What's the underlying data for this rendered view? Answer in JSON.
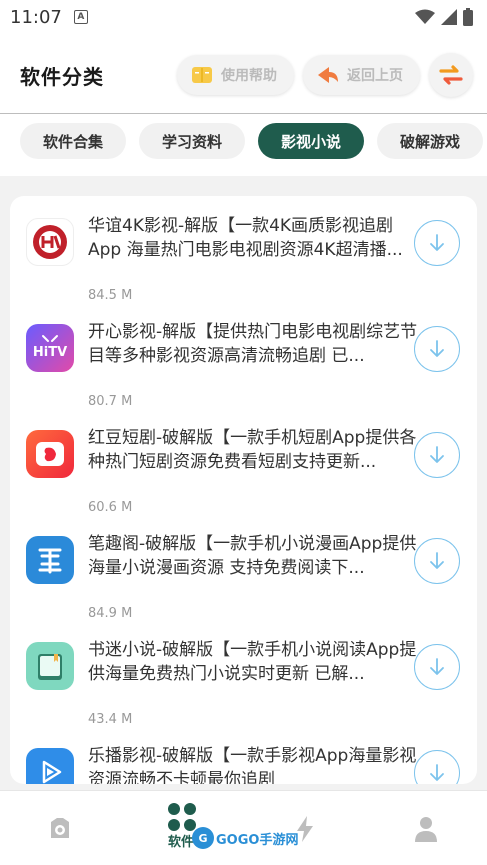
{
  "status_bar": {
    "time": "11:07",
    "notification_letter": "A"
  },
  "header": {
    "title": "软件分类",
    "help_label": "使用帮助",
    "back_label": "返回上页"
  },
  "tabs": [
    {
      "label": "软件合集",
      "active": false
    },
    {
      "label": "学习资料",
      "active": false
    },
    {
      "label": "影视小说",
      "active": true
    },
    {
      "label": "破解游戏",
      "active": false
    }
  ],
  "apps": [
    {
      "title": "华谊4K影视-解版【一款4K画质影视追剧App 海量热门电影电视剧资源4K超清播...",
      "size": "84.5 M",
      "icon": "huayi-4k-icon"
    },
    {
      "title": "开心影视-解版【提供热门电影电视剧综艺节目等多种影视资源高清流畅追剧 已...",
      "size": "80.7 M",
      "icon": "hitv-icon"
    },
    {
      "title": "红豆短剧-破解版【一款手机短剧App提供各种热门短剧资源免费看短剧支持更新...",
      "size": "60.6 M",
      "icon": "hongdou-icon"
    },
    {
      "title": "笔趣阁-破解版【一款手机小说漫画App提供海量小说漫画资源 支持免费阅读下...",
      "size": "84.9 M",
      "icon": "biquge-icon"
    },
    {
      "title": "书迷小说-破解版【一款手机小说阅读App提供海量免费热门小说实时更新 已解...",
      "size": "43.4 M",
      "icon": "shumi-icon"
    },
    {
      "title": "乐播影视-破解版【一款手影视App海量影视资源流畅不卡顿最你追剧",
      "size": "",
      "icon": "lebo-icon"
    }
  ],
  "bottom_nav": {
    "active_label": "软件",
    "watermark_mark": "G",
    "watermark_text": "GOGO手游网"
  },
  "colors": {
    "accent": "#1f5c4d",
    "download_ring": "#7cc3ec",
    "content_bg": "#f2f2f2"
  }
}
